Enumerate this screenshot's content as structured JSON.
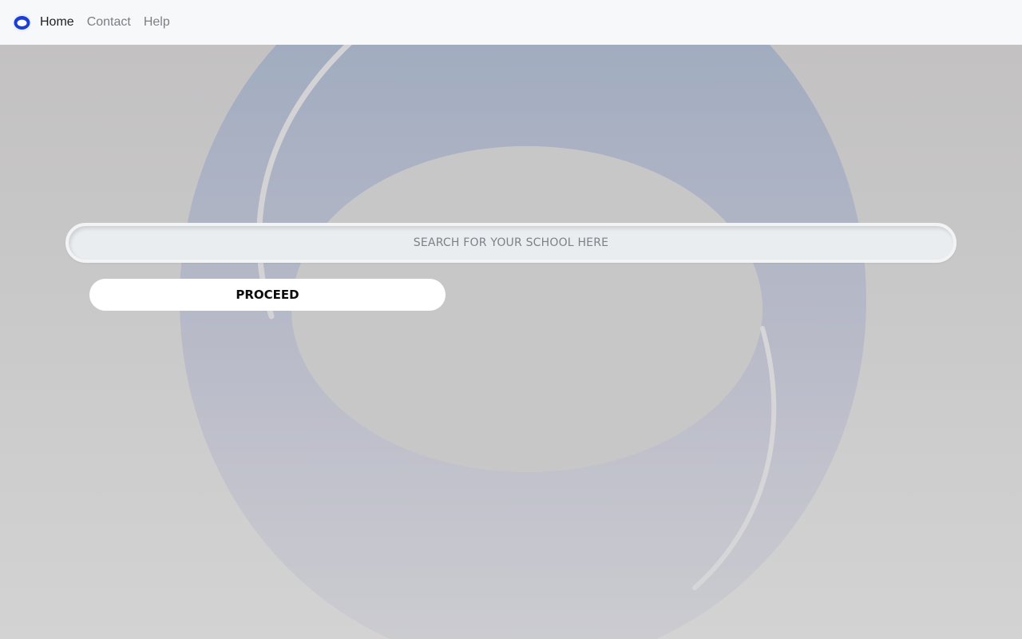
{
  "nav": {
    "logo": "brand-logo",
    "links": [
      {
        "label": "Home",
        "active": true
      },
      {
        "label": "Contact",
        "active": false
      },
      {
        "label": "Help",
        "active": false
      }
    ]
  },
  "search": {
    "placeholder": "SEARCH FOR YOUR SCHOOL HERE",
    "value": ""
  },
  "actions": {
    "proceed_label": "PROCEED"
  },
  "colors": {
    "navbar_bg": "#f7f8fa",
    "logo_blue": "#1a3fd0",
    "watermark_blue": "#9aa8c0",
    "button_bg": "#ffffff"
  }
}
